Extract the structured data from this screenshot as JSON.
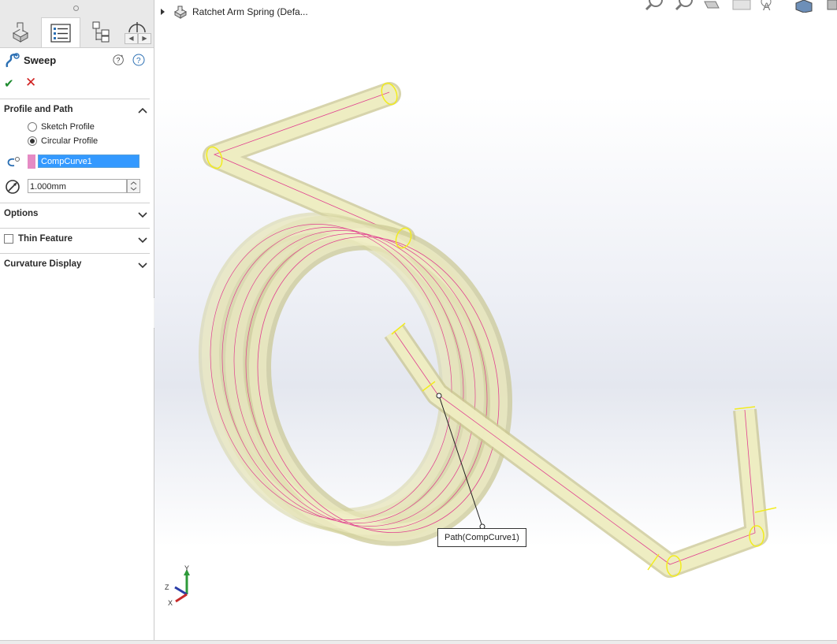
{
  "feature_tree": {
    "model_name": "Ratchet Arm Spring  (Defa..."
  },
  "property_manager": {
    "title": "Sweep",
    "sections": {
      "profile_and_path": {
        "label": "Profile and Path",
        "radio_sketch": "Sketch Profile",
        "radio_circular": "Circular Profile",
        "selected_option": "Circular Profile",
        "path_value": "CompCurve1",
        "diameter_value": "1.000mm"
      },
      "options": {
        "label": "Options"
      },
      "thin_feature": {
        "label": "Thin Feature",
        "checked": false
      },
      "curvature_display": {
        "label": "Curvature Display"
      }
    }
  },
  "viewport": {
    "callout": "Path(CompCurve1)",
    "triad": {
      "x": "X",
      "y": "Y",
      "z": "Z"
    }
  },
  "colors": {
    "accent_selection": "#3399ff",
    "spring_fill": "#f1efbf",
    "path_line": "#e0408f",
    "edge_yellow": "#f2ec1e"
  }
}
